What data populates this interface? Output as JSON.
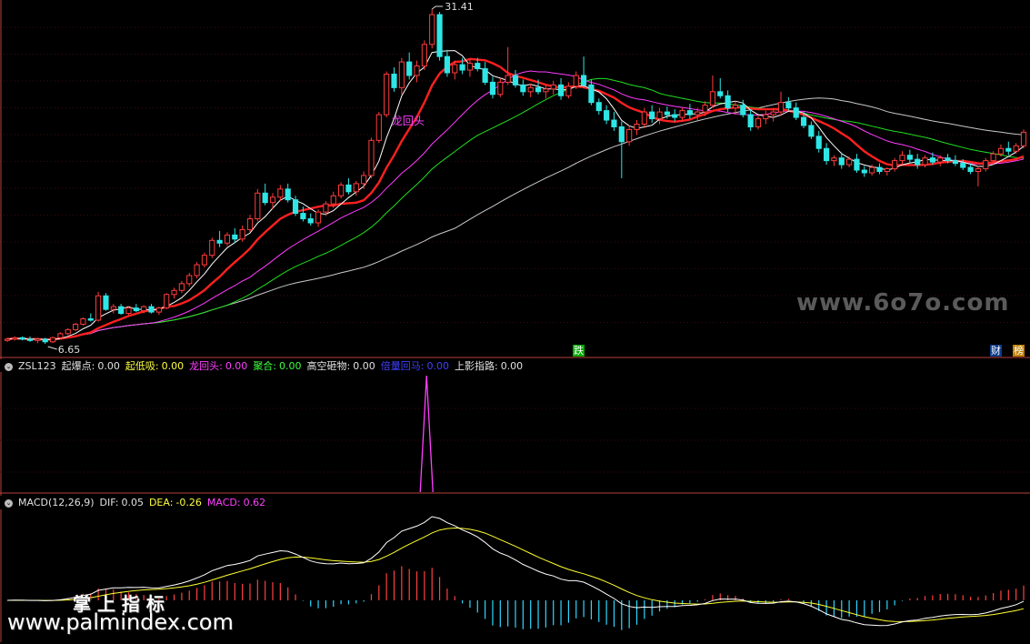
{
  "colors": {
    "background": "#000000",
    "up_candle": "#ff3c3c",
    "down_candle": "#2ee6e6",
    "ma5": "#ffffff",
    "ma10": "#ffff00",
    "ma20": "#ff00ff",
    "ma30": "#00ff00",
    "ma60": "#7f7f7f",
    "panel_divider": "#b8403a"
  },
  "main_panel": {
    "high_label": "31.41",
    "low_label": "6.65",
    "signal_label": "龙回头",
    "event_markers": [
      {
        "text": "跌",
        "color": "#00dd00"
      },
      {
        "text": "财",
        "color": "#4aa0ff"
      },
      {
        "text": "榜",
        "color": "#ffc000"
      }
    ]
  },
  "indicator_panel": {
    "name": "ZSL123",
    "fields": [
      {
        "label": "起爆点:",
        "value": "0.00",
        "color": "#e0e0e0"
      },
      {
        "label": "起低吸:",
        "value": "0.00",
        "color": "#ffff40"
      },
      {
        "label": "龙回头:",
        "value": "0.00",
        "color": "#ff40ff"
      },
      {
        "label": "聚合:",
        "value": "0.00",
        "color": "#40ff40"
      },
      {
        "label": "高空砸物:",
        "value": "0.00",
        "color": "#e0e0e0"
      },
      {
        "label": "倍量回马:",
        "value": "0.00",
        "color": "#4040ff"
      },
      {
        "label": "上影指路:",
        "value": "0.00",
        "color": "#e0e0e0"
      }
    ],
    "spike_color": "#ff40ff"
  },
  "macd_panel": {
    "name": "MACD(12,26,9)",
    "fields": [
      {
        "label": "DIF:",
        "value": "0.05",
        "color": "#e0e0e0"
      },
      {
        "label": "DEA:",
        "value": "-0.26",
        "color": "#ffff40"
      },
      {
        "label": "MACD:",
        "value": "0.62",
        "color": "#ff40ff"
      }
    ]
  },
  "watermarks": {
    "top": "www.6o7o.com",
    "bottom_cn": "掌 上 指 标",
    "bottom_url": "www.palmindex.com"
  },
  "chart_data": {
    "type": "candlestick",
    "price_range": [
      6.65,
      31.41
    ],
    "candles_ohlc": [
      [
        6.9,
        7.1,
        6.8,
        7.0
      ],
      [
        7.0,
        7.2,
        6.9,
        7.1
      ],
      [
        7.1,
        7.2,
        6.9,
        7.0
      ],
      [
        7.0,
        7.2,
        6.8,
        6.9
      ],
      [
        6.9,
        7.1,
        6.7,
        7.0
      ],
      [
        7.0,
        7.1,
        6.65,
        6.8
      ],
      [
        6.8,
        7.2,
        6.7,
        7.1
      ],
      [
        7.1,
        7.5,
        7.0,
        7.4
      ],
      [
        7.4,
        7.8,
        7.3,
        7.7
      ],
      [
        7.7,
        8.2,
        7.6,
        8.1
      ],
      [
        8.1,
        8.6,
        8.0,
        8.5
      ],
      [
        8.5,
        8.9,
        8.3,
        8.4
      ],
      [
        8.4,
        10.5,
        8.3,
        10.2
      ],
      [
        10.2,
        10.4,
        9.1,
        9.2
      ],
      [
        9.2,
        9.6,
        8.9,
        9.4
      ],
      [
        9.4,
        9.6,
        8.8,
        8.9
      ],
      [
        8.9,
        9.4,
        8.8,
        9.3
      ],
      [
        9.3,
        9.6,
        9.0,
        9.1
      ],
      [
        9.1,
        9.5,
        8.9,
        9.4
      ],
      [
        9.4,
        9.6,
        8.9,
        9.0
      ],
      [
        9.0,
        9.4,
        8.8,
        9.3
      ],
      [
        9.3,
        10.4,
        9.2,
        10.3
      ],
      [
        10.3,
        10.8,
        10.0,
        10.6
      ],
      [
        10.6,
        11.3,
        10.4,
        11.1
      ],
      [
        11.1,
        11.9,
        10.9,
        11.7
      ],
      [
        11.7,
        12.7,
        11.5,
        12.5
      ],
      [
        12.5,
        13.4,
        12.3,
        13.2
      ],
      [
        13.2,
        14.5,
        13.0,
        14.3
      ],
      [
        14.3,
        15.0,
        13.8,
        14.1
      ],
      [
        14.1,
        14.9,
        13.9,
        14.7
      ],
      [
        14.7,
        15.2,
        14.1,
        14.4
      ],
      [
        14.4,
        15.4,
        14.2,
        15.1
      ],
      [
        15.1,
        16.2,
        14.9,
        15.9
      ],
      [
        15.9,
        18.1,
        15.7,
        17.8
      ],
      [
        17.8,
        18.5,
        16.9,
        17.1
      ],
      [
        17.1,
        17.8,
        16.6,
        17.5
      ],
      [
        17.5,
        18.4,
        17.2,
        18.1
      ],
      [
        18.1,
        18.5,
        17.1,
        17.3
      ],
      [
        17.3,
        17.6,
        16.1,
        16.3
      ],
      [
        16.3,
        16.8,
        15.7,
        15.9
      ],
      [
        15.9,
        16.3,
        15.4,
        15.6
      ],
      [
        15.6,
        16.6,
        15.3,
        16.4
      ],
      [
        16.4,
        17.2,
        16.1,
        17.0
      ],
      [
        17.0,
        17.9,
        16.7,
        17.6
      ],
      [
        17.6,
        18.6,
        17.4,
        18.4
      ],
      [
        18.4,
        18.9,
        17.7,
        17.9
      ],
      [
        17.9,
        18.7,
        17.6,
        18.5
      ],
      [
        18.5,
        19.4,
        18.1,
        19.1
      ],
      [
        19.1,
        21.9,
        18.9,
        21.7
      ],
      [
        21.7,
        23.8,
        21.5,
        23.6
      ],
      [
        23.6,
        26.8,
        23.4,
        26.6
      ],
      [
        26.6,
        27.1,
        25.3,
        25.6
      ],
      [
        25.6,
        27.8,
        25.1,
        27.5
      ],
      [
        27.5,
        28.2,
        26.2,
        26.5
      ],
      [
        26.5,
        27.6,
        26.0,
        27.2
      ],
      [
        27.2,
        29.1,
        26.9,
        28.8
      ],
      [
        28.8,
        31.41,
        28.5,
        31.0
      ],
      [
        31.0,
        31.2,
        27.6,
        27.9
      ],
      [
        27.9,
        28.4,
        26.4,
        26.7
      ],
      [
        26.7,
        27.6,
        26.2,
        27.3
      ],
      [
        27.3,
        27.8,
        26.6,
        26.9
      ],
      [
        26.9,
        27.7,
        26.4,
        27.4
      ],
      [
        27.4,
        27.8,
        26.8,
        27.0
      ],
      [
        27.0,
        27.5,
        25.8,
        26.0
      ],
      [
        26.0,
        26.4,
        24.8,
        25.1
      ],
      [
        25.1,
        26.3,
        24.9,
        26.0
      ],
      [
        26.0,
        28.6,
        25.8,
        26.5
      ],
      [
        26.5,
        26.9,
        25.6,
        25.8
      ],
      [
        25.8,
        26.2,
        25.0,
        25.3
      ],
      [
        25.3,
        25.9,
        24.9,
        25.6
      ],
      [
        25.6,
        26.2,
        25.1,
        25.3
      ],
      [
        25.3,
        25.8,
        24.8,
        25.5
      ],
      [
        25.5,
        26.1,
        25.1,
        25.8
      ],
      [
        25.8,
        26.3,
        24.7,
        25.0
      ],
      [
        25.0,
        26.0,
        24.8,
        25.7
      ],
      [
        25.7,
        26.8,
        25.5,
        26.5
      ],
      [
        26.5,
        27.9,
        25.6,
        25.8
      ],
      [
        25.8,
        26.2,
        24.3,
        24.5
      ],
      [
        24.5,
        24.8,
        23.6,
        23.9
      ],
      [
        23.9,
        24.3,
        22.9,
        23.2
      ],
      [
        23.2,
        23.8,
        22.4,
        22.7
      ],
      [
        22.7,
        23.1,
        18.9,
        21.6
      ],
      [
        21.6,
        22.8,
        21.3,
        22.5
      ],
      [
        22.5,
        23.2,
        22.1,
        22.9
      ],
      [
        22.9,
        24.1,
        22.6,
        23.8
      ],
      [
        23.8,
        24.3,
        23.0,
        23.3
      ],
      [
        23.3,
        24.1,
        22.9,
        23.8
      ],
      [
        23.8,
        24.2,
        23.3,
        23.6
      ],
      [
        23.6,
        24.0,
        23.1,
        23.4
      ],
      [
        23.4,
        24.1,
        23.1,
        23.9
      ],
      [
        23.9,
        24.4,
        23.3,
        23.6
      ],
      [
        23.6,
        24.1,
        23.2,
        23.8
      ],
      [
        23.8,
        24.6,
        23.5,
        24.3
      ],
      [
        24.3,
        26.5,
        24.1,
        25.3
      ],
      [
        25.3,
        26.3,
        24.8,
        25.0
      ],
      [
        25.0,
        25.4,
        23.8,
        24.1
      ],
      [
        24.1,
        24.6,
        23.6,
        24.3
      ],
      [
        24.3,
        24.7,
        23.4,
        23.6
      ],
      [
        23.6,
        24.0,
        22.4,
        22.7
      ],
      [
        22.7,
        23.6,
        22.5,
        23.3
      ],
      [
        23.3,
        23.9,
        22.9,
        23.6
      ],
      [
        23.6,
        24.1,
        23.1,
        23.8
      ],
      [
        23.8,
        25.3,
        23.5,
        24.5
      ],
      [
        24.5,
        24.9,
        23.9,
        24.1
      ],
      [
        24.1,
        24.5,
        23.2,
        23.4
      ],
      [
        23.4,
        23.8,
        22.6,
        22.8
      ],
      [
        22.8,
        23.1,
        21.8,
        22.0
      ],
      [
        22.0,
        22.4,
        20.8,
        21.1
      ],
      [
        21.1,
        21.5,
        19.9,
        20.2
      ],
      [
        20.2,
        20.6,
        19.8,
        20.4
      ],
      [
        20.4,
        20.8,
        19.6,
        19.9
      ],
      [
        19.9,
        20.5,
        19.7,
        20.3
      ],
      [
        20.3,
        20.7,
        19.3,
        19.5
      ],
      [
        19.5,
        19.8,
        19.0,
        19.3
      ],
      [
        19.3,
        19.9,
        19.1,
        19.7
      ],
      [
        19.7,
        20.0,
        19.2,
        19.4
      ],
      [
        19.4,
        19.7,
        19.1,
        19.6
      ],
      [
        19.6,
        20.4,
        19.4,
        20.2
      ],
      [
        20.2,
        20.9,
        19.9,
        20.6
      ],
      [
        20.6,
        21.0,
        20.0,
        20.3
      ],
      [
        20.3,
        20.7,
        19.6,
        19.9
      ],
      [
        19.9,
        20.6,
        19.7,
        20.4
      ],
      [
        20.4,
        20.8,
        19.9,
        20.1
      ],
      [
        20.1,
        20.6,
        19.8,
        20.4
      ],
      [
        20.4,
        20.7,
        20.0,
        20.2
      ],
      [
        20.2,
        20.6,
        19.8,
        20.0
      ],
      [
        20.0,
        20.3,
        19.5,
        19.7
      ],
      [
        19.7,
        20.0,
        19.2,
        19.4
      ],
      [
        19.4,
        19.8,
        18.3,
        19.6
      ],
      [
        19.6,
        20.4,
        19.4,
        20.2
      ],
      [
        20.2,
        20.9,
        19.9,
        20.7
      ],
      [
        20.7,
        21.4,
        20.5,
        21.1
      ],
      [
        21.1,
        21.6,
        20.6,
        20.9
      ],
      [
        20.9,
        21.5,
        20.7,
        21.3
      ],
      [
        21.3,
        22.5,
        21.1,
        22.3
      ]
    ],
    "ma_periods": [
      5,
      10,
      20,
      30,
      60
    ],
    "macd": {
      "dif": 0.05,
      "dea": -0.26,
      "macd": 0.62
    }
  }
}
